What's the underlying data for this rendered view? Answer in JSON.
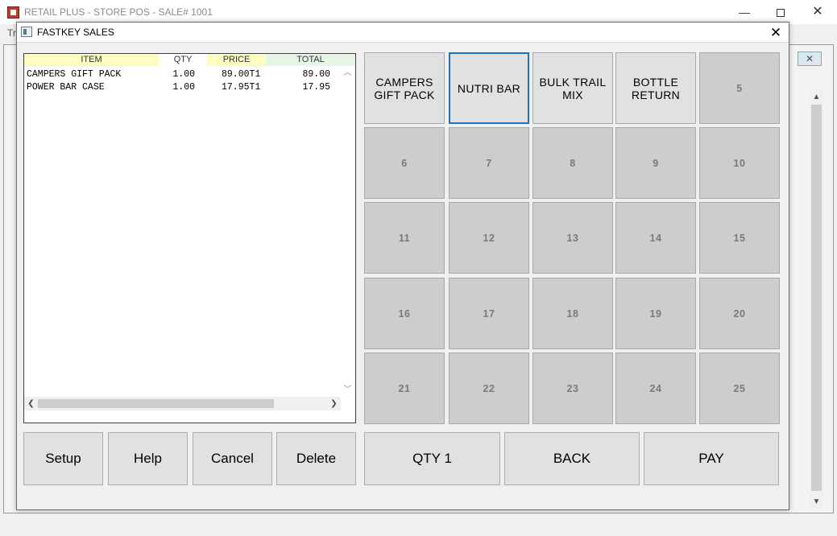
{
  "main_window": {
    "title": "RETAIL PLUS  -  STORE POS  -  SALE# 1001",
    "menu_hint": "Tr"
  },
  "dialog": {
    "title": "FASTKEY SALES"
  },
  "item_list": {
    "columns": [
      "ITEM",
      "QTY",
      "PRICE",
      "TOTAL"
    ],
    "rows": [
      {
        "item": "CAMPERS GIFT PACK",
        "qty": "1.00",
        "price": "89.00T1",
        "total": "89.00"
      },
      {
        "item": "POWER BAR CASE",
        "qty": "1.00",
        "price": "17.95T1",
        "total": "17.95"
      }
    ]
  },
  "fastkeys": [
    "CAMPERS\nGIFT PACK",
    "NUTRI BAR",
    "BULK TRAIL\nMIX",
    "BOTTLE\nRETURN",
    "5",
    "6",
    "7",
    "8",
    "9",
    "10",
    "11",
    "12",
    "13",
    "14",
    "15",
    "16",
    "17",
    "18",
    "19",
    "20",
    "21",
    "22",
    "23",
    "24",
    "25"
  ],
  "buttons": {
    "setup": "Setup",
    "help": "Help",
    "cancel": "Cancel",
    "delete": "Delete",
    "qty": "QTY 1",
    "back": "BACK",
    "pay": "PAY"
  },
  "colors": {
    "selected_border": "#1f6fc0",
    "header_yellow": "#fdfdc2",
    "header_green": "#e6f6e6"
  }
}
